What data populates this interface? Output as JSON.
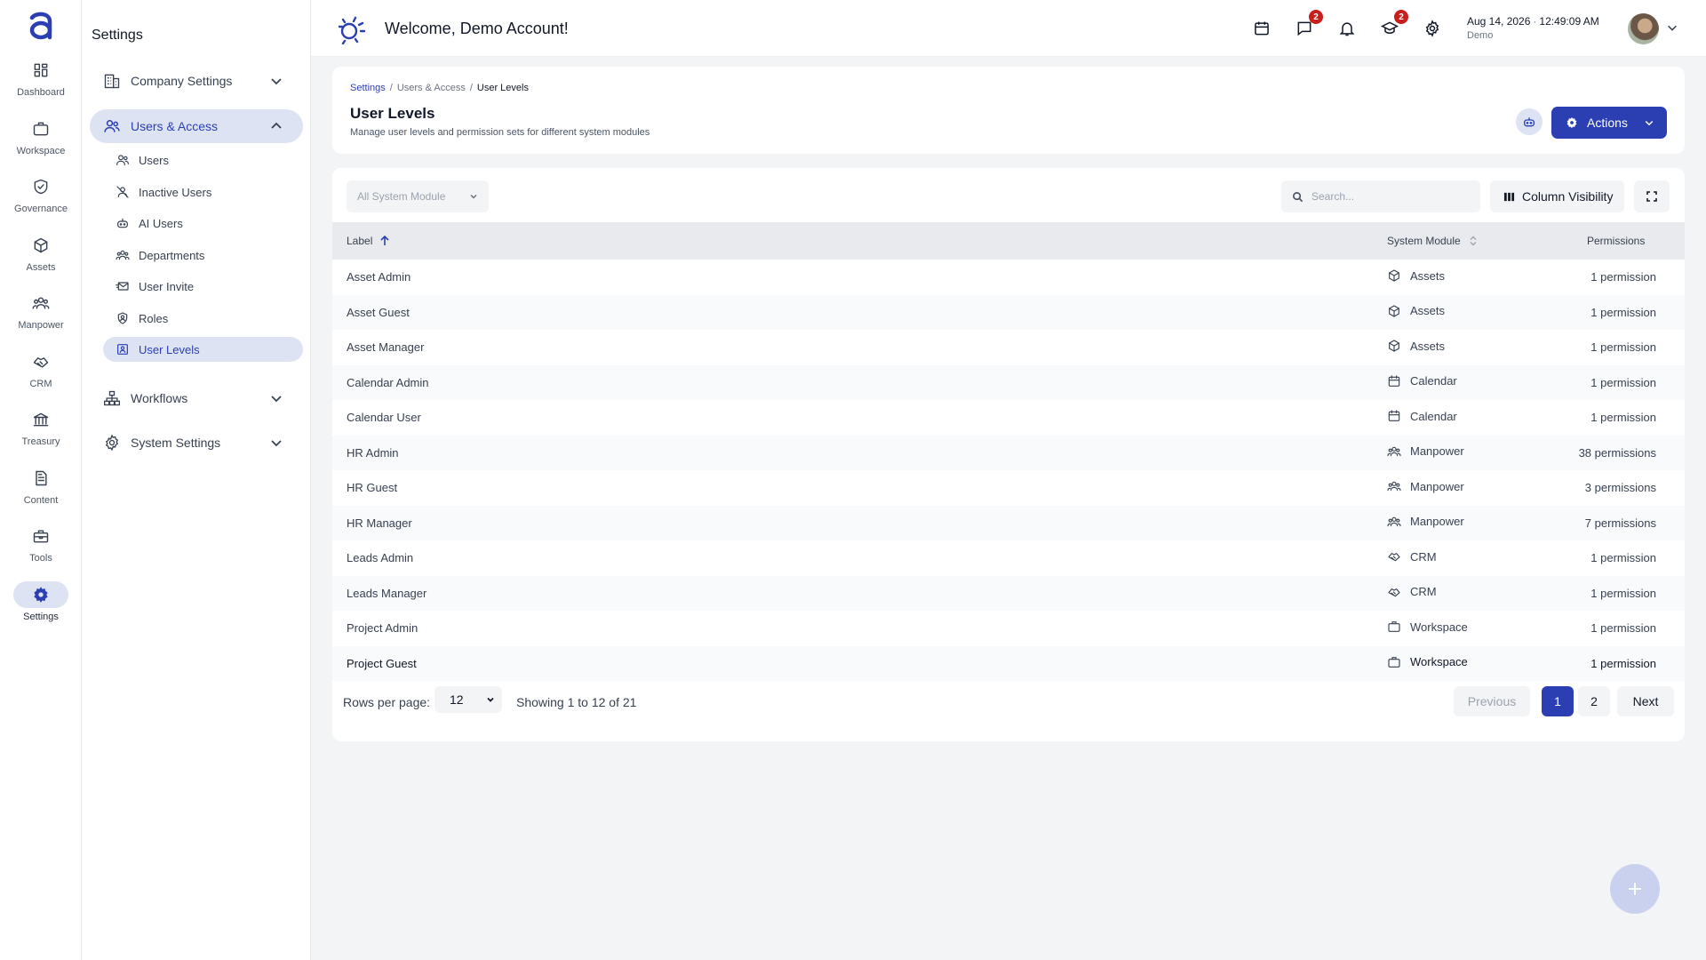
{
  "nav": {
    "items": [
      {
        "label": "Dashboard",
        "icon": "dashboard-icon"
      },
      {
        "label": "Workspace",
        "icon": "briefcase-icon"
      },
      {
        "label": "Governance",
        "icon": "shield-check-icon"
      },
      {
        "label": "Assets",
        "icon": "cube-icon"
      },
      {
        "label": "Manpower",
        "icon": "people-icon"
      },
      {
        "label": "CRM",
        "icon": "handshake-icon"
      },
      {
        "label": "Treasury",
        "icon": "bank-icon"
      },
      {
        "label": "Content",
        "icon": "document-icon"
      },
      {
        "label": "Tools",
        "icon": "toolbox-icon"
      },
      {
        "label": "Settings",
        "icon": "gear-icon",
        "active": true
      }
    ]
  },
  "sidebar": {
    "title": "Settings",
    "groups": [
      {
        "label": "Company Settings",
        "icon": "building-icon"
      },
      {
        "label": "Users & Access",
        "icon": "users-icon",
        "open": true
      },
      {
        "label": "Workflows",
        "icon": "sitemap-icon"
      },
      {
        "label": "System Settings",
        "icon": "gear-icon"
      }
    ],
    "sub_items": [
      {
        "label": "Users",
        "icon": "users-icon"
      },
      {
        "label": "Inactive Users",
        "icon": "user-off-icon"
      },
      {
        "label": "AI Users",
        "icon": "robot-icon"
      },
      {
        "label": "Departments",
        "icon": "people-icon"
      },
      {
        "label": "User Invite",
        "icon": "mail-icon"
      },
      {
        "label": "Roles",
        "icon": "badge-icon"
      },
      {
        "label": "User Levels",
        "icon": "id-card-icon",
        "active": true
      }
    ]
  },
  "topbar": {
    "welcome": "Welcome, Demo Account!",
    "messages_badge": "2",
    "learning_badge": "2",
    "date": "Aug 14, 2026",
    "time": "12:49:09 AM",
    "user_sub": "Demo"
  },
  "header": {
    "breadcrumbs": [
      "Settings",
      "Users & Access",
      "User Levels"
    ],
    "title": "User Levels",
    "subtitle": "Manage user levels and permission sets for different system modules",
    "actions_label": "Actions"
  },
  "toolbar": {
    "filter_label": "All System Module",
    "search_placeholder": "Search...",
    "column_visibility": "Column Visibility"
  },
  "table": {
    "columns": [
      "Label",
      "System Module",
      "Permissions"
    ],
    "rows": [
      {
        "label": "Asset Admin",
        "module": "Assets",
        "module_icon": "cube-icon",
        "permissions": "1 permission"
      },
      {
        "label": "Asset Guest",
        "module": "Assets",
        "module_icon": "cube-icon",
        "permissions": "1 permission"
      },
      {
        "label": "Asset Manager",
        "module": "Assets",
        "module_icon": "cube-icon",
        "permissions": "1 permission"
      },
      {
        "label": "Calendar Admin",
        "module": "Calendar",
        "module_icon": "calendar-icon",
        "permissions": "1 permission"
      },
      {
        "label": "Calendar User",
        "module": "Calendar",
        "module_icon": "calendar-icon",
        "permissions": "1 permission"
      },
      {
        "label": "HR Admin",
        "module": "Manpower",
        "module_icon": "people-icon",
        "permissions": "38 permissions"
      },
      {
        "label": "HR Guest",
        "module": "Manpower",
        "module_icon": "people-icon",
        "permissions": "3 permissions"
      },
      {
        "label": "HR Manager",
        "module": "Manpower",
        "module_icon": "people-icon",
        "permissions": "7 permissions"
      },
      {
        "label": "Leads Admin",
        "module": "CRM",
        "module_icon": "handshake-icon",
        "permissions": "1 permission"
      },
      {
        "label": "Leads Manager",
        "module": "CRM",
        "module_icon": "handshake-icon",
        "permissions": "1 permission"
      },
      {
        "label": "Project Admin",
        "module": "Workspace",
        "module_icon": "briefcase-icon",
        "permissions": "1 permission"
      },
      {
        "label": "Project Guest",
        "module": "Workspace",
        "module_icon": "briefcase-icon",
        "permissions": "1 permission"
      }
    ]
  },
  "pagination": {
    "rows_per_page_label": "Rows per page:",
    "rows_per_page": "12",
    "showing": "Showing 1 to 12 of 21",
    "previous": "Previous",
    "pages": [
      "1",
      "2"
    ],
    "current_page": "1",
    "next": "Next"
  },
  "colors": {
    "primary": "#2b3fb3",
    "active_bg": "#dde3f3",
    "badge": "#c81e1e"
  }
}
